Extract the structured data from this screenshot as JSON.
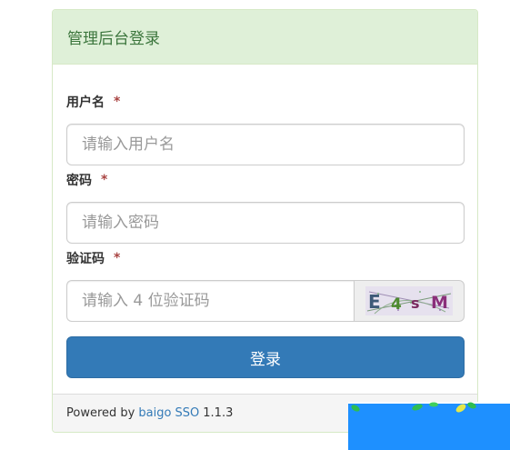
{
  "panel": {
    "title": "管理后台登录"
  },
  "form": {
    "username": {
      "label": "用户名",
      "required_mark": "*",
      "placeholder": "请输入用户名",
      "value": ""
    },
    "password": {
      "label": "密码",
      "required_mark": "*",
      "placeholder": "请输入密码",
      "value": ""
    },
    "captcha": {
      "label": "验证码",
      "required_mark": "*",
      "placeholder": "请输入 4 位验证码",
      "value": "",
      "image_text": "E4sM"
    },
    "submit_label": "登录"
  },
  "footer": {
    "powered_by": "Powered by",
    "link_text": "baigo SSO",
    "version": "1.1.3"
  },
  "colors": {
    "heading_bg": "#dff0d8",
    "heading_text": "#3c763d",
    "primary_button": "#337ab7",
    "required_star": "#a94442",
    "link": "#337ab7",
    "corner_deco": "#1e90ff"
  }
}
